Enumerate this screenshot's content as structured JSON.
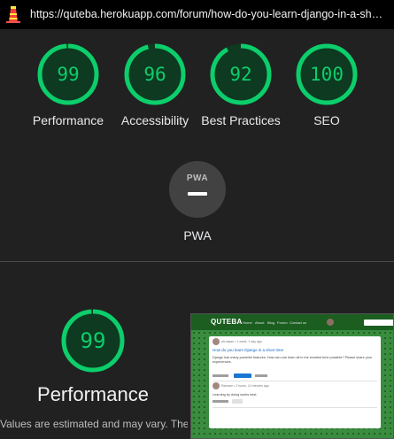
{
  "browser": {
    "url": "https://quteba.herokuapp.com/forum/how-do-you-learn-django-in-a-sh…",
    "tab_icon": "lighthouse-icon"
  },
  "categories": [
    {
      "label": "Performance",
      "score": "99",
      "fraction": 0.99
    },
    {
      "label": "Accessibility",
      "score": "96",
      "fraction": 0.96
    },
    {
      "label": "Best Practices",
      "score": "92",
      "fraction": 0.92
    },
    {
      "label": "SEO",
      "score": "100",
      "fraction": 1.0
    }
  ],
  "pwa": {
    "badge_text": "PWA",
    "label": "PWA"
  },
  "performance_section": {
    "score": "99",
    "fraction": 0.99,
    "title": "Performance",
    "note": "Values are estimated and may vary. The"
  },
  "colors": {
    "pass": "#0cce6b",
    "pass_bg": "#0d3a21",
    "background": "#212121"
  },
  "screenshot": {
    "brand": "QUTEBA",
    "nav_links": [
      "Home",
      "About",
      "Blog",
      "Forum",
      "Contact us"
    ],
    "search_placeholder": "Search here",
    "question_meta": "ali-hasan • 1 week, 1 day ago",
    "question_title": "How do you learn Django in a short time",
    "question_body": "Django has many powerful features. How can one learn all in the shortest time possible? Please share your experiences.",
    "action_label": "Comment",
    "reply_meta": "Ramzan • 2 hours, 14 minutes ago",
    "reply_body": "Learning by doing works best."
  }
}
